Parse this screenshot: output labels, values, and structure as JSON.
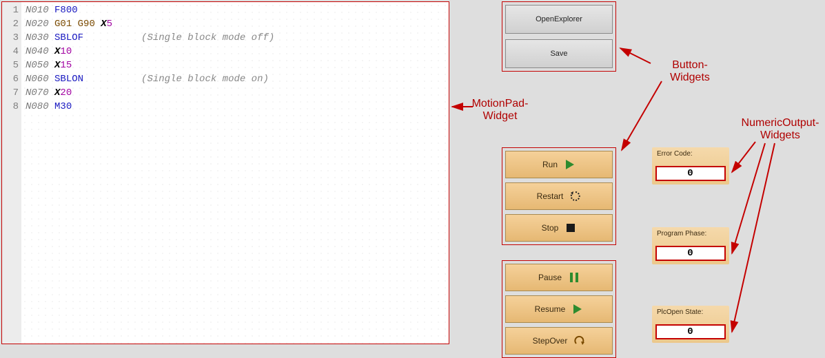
{
  "editor": {
    "lines": [
      {
        "n": "N010",
        "tokens": [
          [
            "f",
            "F800"
          ]
        ]
      },
      {
        "n": "N020",
        "tokens": [
          [
            "g",
            "G01"
          ],
          [
            "sp",
            " "
          ],
          [
            "g",
            "G90"
          ],
          [
            "sp",
            " "
          ],
          [
            "xk",
            "X"
          ],
          [
            "xn",
            "5"
          ]
        ]
      },
      {
        "n": "N030",
        "tokens": [
          [
            "kw",
            "SBLOF"
          ],
          [
            "sp",
            "          "
          ],
          [
            "cmt",
            "(Single block mode off)"
          ]
        ]
      },
      {
        "n": "N040",
        "tokens": [
          [
            "xk",
            "X"
          ],
          [
            "xn",
            "10"
          ]
        ]
      },
      {
        "n": "N050",
        "tokens": [
          [
            "xk",
            "X"
          ],
          [
            "xn",
            "15"
          ]
        ]
      },
      {
        "n": "N060",
        "tokens": [
          [
            "kw",
            "SBLON"
          ],
          [
            "sp",
            "          "
          ],
          [
            "cmt",
            "(Single block mode on)"
          ]
        ]
      },
      {
        "n": "N070",
        "tokens": [
          [
            "xk",
            "X"
          ],
          [
            "xn",
            "20"
          ]
        ]
      },
      {
        "n": "N080",
        "tokens": [
          [
            "kw",
            "M30"
          ]
        ]
      }
    ]
  },
  "file_buttons": {
    "open": "OpenExplorer",
    "save": "Save"
  },
  "run_buttons": {
    "run": "Run",
    "restart": "Restart",
    "stop": "Stop"
  },
  "step_buttons": {
    "pause": "Pause",
    "resume": "Resume",
    "stepover": "StepOver"
  },
  "outputs": {
    "error": {
      "label": "Error Code:",
      "value": "0"
    },
    "phase": {
      "label": "Program Phase:",
      "value": "0"
    },
    "plcopen": {
      "label": "PlcOpen State:",
      "value": "0"
    }
  },
  "annotations": {
    "button": "Button-\nWidgets",
    "motion": "MotionPad-\nWidget",
    "numeric": "NumericOutput-\nWidgets"
  },
  "colors": {
    "callout": "#c40000",
    "orange": "#e9bf82"
  }
}
